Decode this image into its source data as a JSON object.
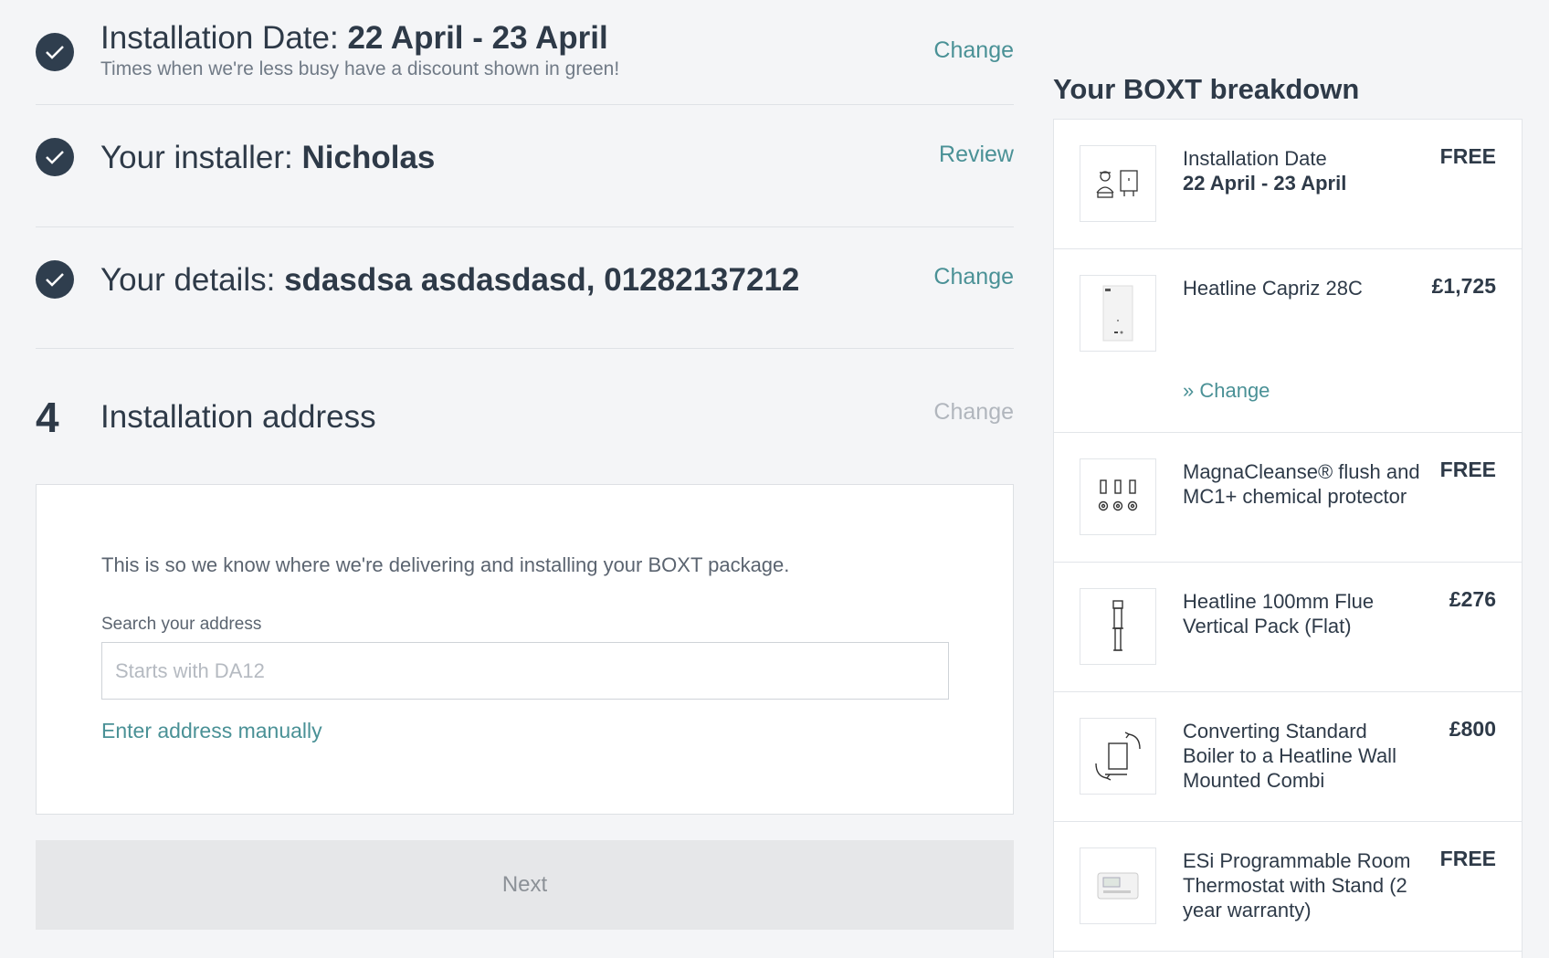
{
  "steps": [
    {
      "label": "Installation Date: ",
      "value": "22 April - 23 April",
      "sub": "Times when we're less busy have a discount shown in green!",
      "link": "Change"
    },
    {
      "label": "Your installer: ",
      "value": "Nicholas",
      "link": "Review"
    },
    {
      "label": "Your details: ",
      "value": "sdasdsa asdasdasd, 01282137212",
      "link": "Change"
    },
    {
      "number": "4",
      "label": "Installation address",
      "link": "Change"
    }
  ],
  "address": {
    "info": "This is so we know where we're delivering and installing your BOXT package.",
    "search_label": "Search your address",
    "placeholder": "Starts with DA12",
    "manual_link": "Enter address manually"
  },
  "next_label": "Next",
  "breakdown": {
    "title": "Your BOXT breakdown",
    "items": [
      {
        "name": "Installation Date",
        "sub": "22 April - 23 April",
        "price": "FREE",
        "icon": "installer-icon"
      },
      {
        "name": "Heatline Capriz 28C",
        "price": "£1,725",
        "change": "» Change",
        "icon": "boiler-image"
      },
      {
        "name": "MagnaCleanse® flush and MC1+ chemical protector",
        "price": "FREE",
        "icon": "magnacleanse-icon"
      },
      {
        "name": "Heatline 100mm Flue Vertical Pack (Flat)",
        "price": "£276",
        "icon": "flue-icon"
      },
      {
        "name": "Converting Standard Boiler to a Heatline Wall Mounted Combi",
        "price": "£800",
        "icon": "conversion-icon"
      },
      {
        "name": "ESi Programmable Room Thermostat with Stand (2 year warranty)",
        "price": "FREE",
        "icon": "thermostat-image"
      }
    ]
  },
  "colors": {
    "accent": "#4a9196",
    "dark": "#2f3e4e",
    "muted": "#b1b6bd",
    "background": "#f4f5f7"
  }
}
